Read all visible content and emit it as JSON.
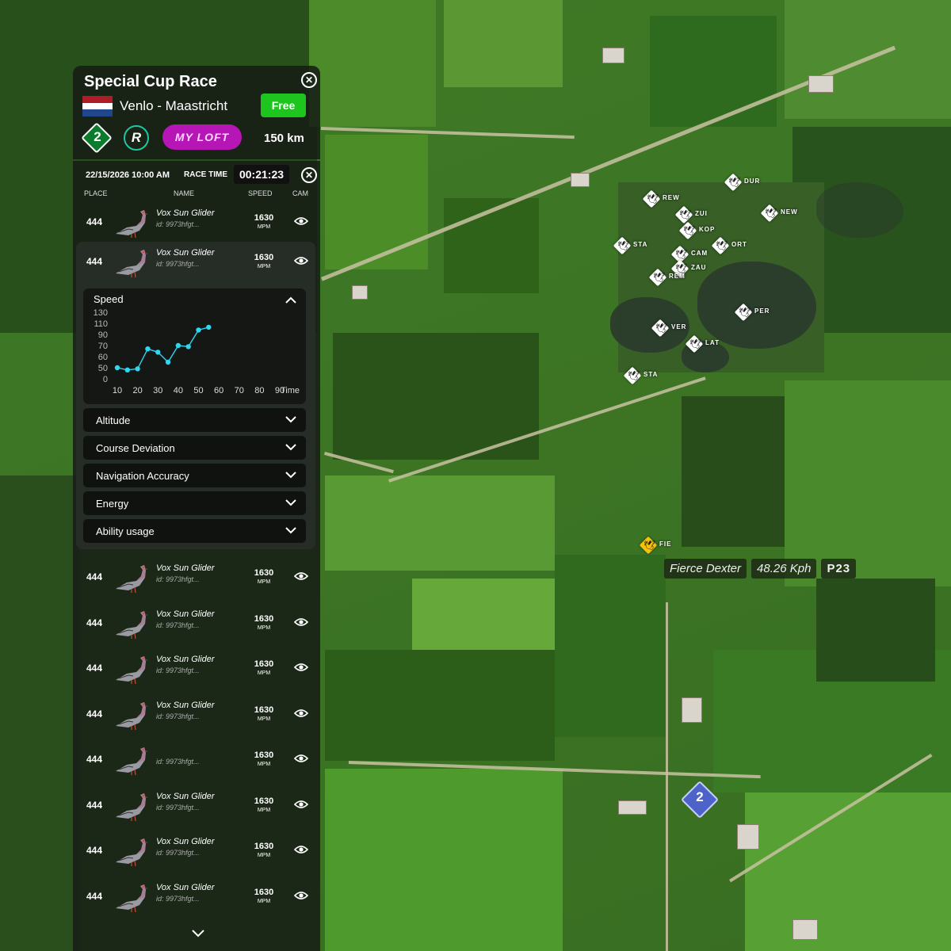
{
  "race": {
    "title": "Special Cup Race",
    "route": "Venlo - Maastricht",
    "free_label": "Free",
    "tier_badge": "2",
    "r_logo": "R",
    "my_loft_label": "MY LOFT",
    "distance": "150 km",
    "datetime": "22/15/2026  10:00 AM",
    "race_time_label": "RACE TIME",
    "race_time": "00:21:23",
    "flag_colors": [
      "#ae1c28",
      "#ffffff",
      "#21468b"
    ]
  },
  "table": {
    "headers": {
      "place": "PLACE",
      "name": "NAME",
      "speed": "SPEED",
      "cam": "CAM"
    },
    "rows": [
      {
        "place": "444",
        "name": "Vox Sun Glider",
        "id": "id: 9973hfgt...",
        "speed": "1630",
        "unit": "MPM"
      },
      {
        "place": "444",
        "name": "Vox Sun Glider",
        "id": "id: 9973hfgt...",
        "speed": "1630",
        "unit": "MPM"
      },
      {
        "place": "444",
        "name": "Vox Sun Glider",
        "id": "id: 9973hfgt...",
        "speed": "1630",
        "unit": "MPM"
      },
      {
        "place": "444",
        "name": "Vox Sun Glider",
        "id": "id: 9973hfgt...",
        "speed": "1630",
        "unit": "MPM"
      },
      {
        "place": "444",
        "name": "Vox Sun Glider",
        "id": "id: 9973hfgt...",
        "speed": "1630",
        "unit": "MPM"
      },
      {
        "place": "444",
        "name": "Vox Sun Glider",
        "id": "id: 9973hfgt...",
        "speed": "1630",
        "unit": "MPM"
      },
      {
        "place": "444",
        "name": "",
        "id": "id: 9973hfgt...",
        "speed": "1630",
        "unit": "MPM"
      },
      {
        "place": "444",
        "name": "Vox Sun Glider",
        "id": "id: 9973hfgt...",
        "speed": "1630",
        "unit": "MPM"
      },
      {
        "place": "444",
        "name": "Vox Sun Glider",
        "id": "id: 9973hfgt...",
        "speed": "1630",
        "unit": "MPM"
      },
      {
        "place": "444",
        "name": "Vox Sun Glider",
        "id": "id: 9973hfgt...",
        "speed": "1630",
        "unit": "MPM"
      }
    ]
  },
  "sections": [
    "Altitude",
    "Course Deviation",
    "Navigation Accuracy",
    "Energy",
    "Ability usage"
  ],
  "chart_data": {
    "type": "line",
    "title": "Speed",
    "xlabel": "Time",
    "ylabel": "",
    "x": [
      10,
      15,
      20,
      25,
      30,
      35,
      40,
      45,
      50,
      55
    ],
    "values": [
      50,
      40,
      45,
      67,
      64,
      55,
      70,
      69,
      98,
      103
    ],
    "xticks": [
      10,
      20,
      30,
      40,
      50,
      60,
      70,
      80,
      90
    ],
    "yticks": [
      0,
      50,
      60,
      70,
      90,
      110,
      130
    ],
    "ylim": [
      0,
      130
    ],
    "line_color": "#2fd6f0"
  },
  "map": {
    "markers": [
      {
        "label": "DUR"
      },
      {
        "label": "REW"
      },
      {
        "label": "ZUI"
      },
      {
        "label": "NEW"
      },
      {
        "label": "KOP"
      },
      {
        "label": "STA"
      },
      {
        "label": "ORT"
      },
      {
        "label": "CAM"
      },
      {
        "label": "ZAU"
      },
      {
        "label": "REM"
      },
      {
        "label": "PER"
      },
      {
        "label": "VER"
      },
      {
        "label": "LAT"
      },
      {
        "label": "STA"
      }
    ],
    "highlight": {
      "label": "FIE",
      "name": "Fierce Dexter",
      "speed": "48.26 Kph",
      "position": "P23"
    },
    "loft_badge": "2"
  }
}
